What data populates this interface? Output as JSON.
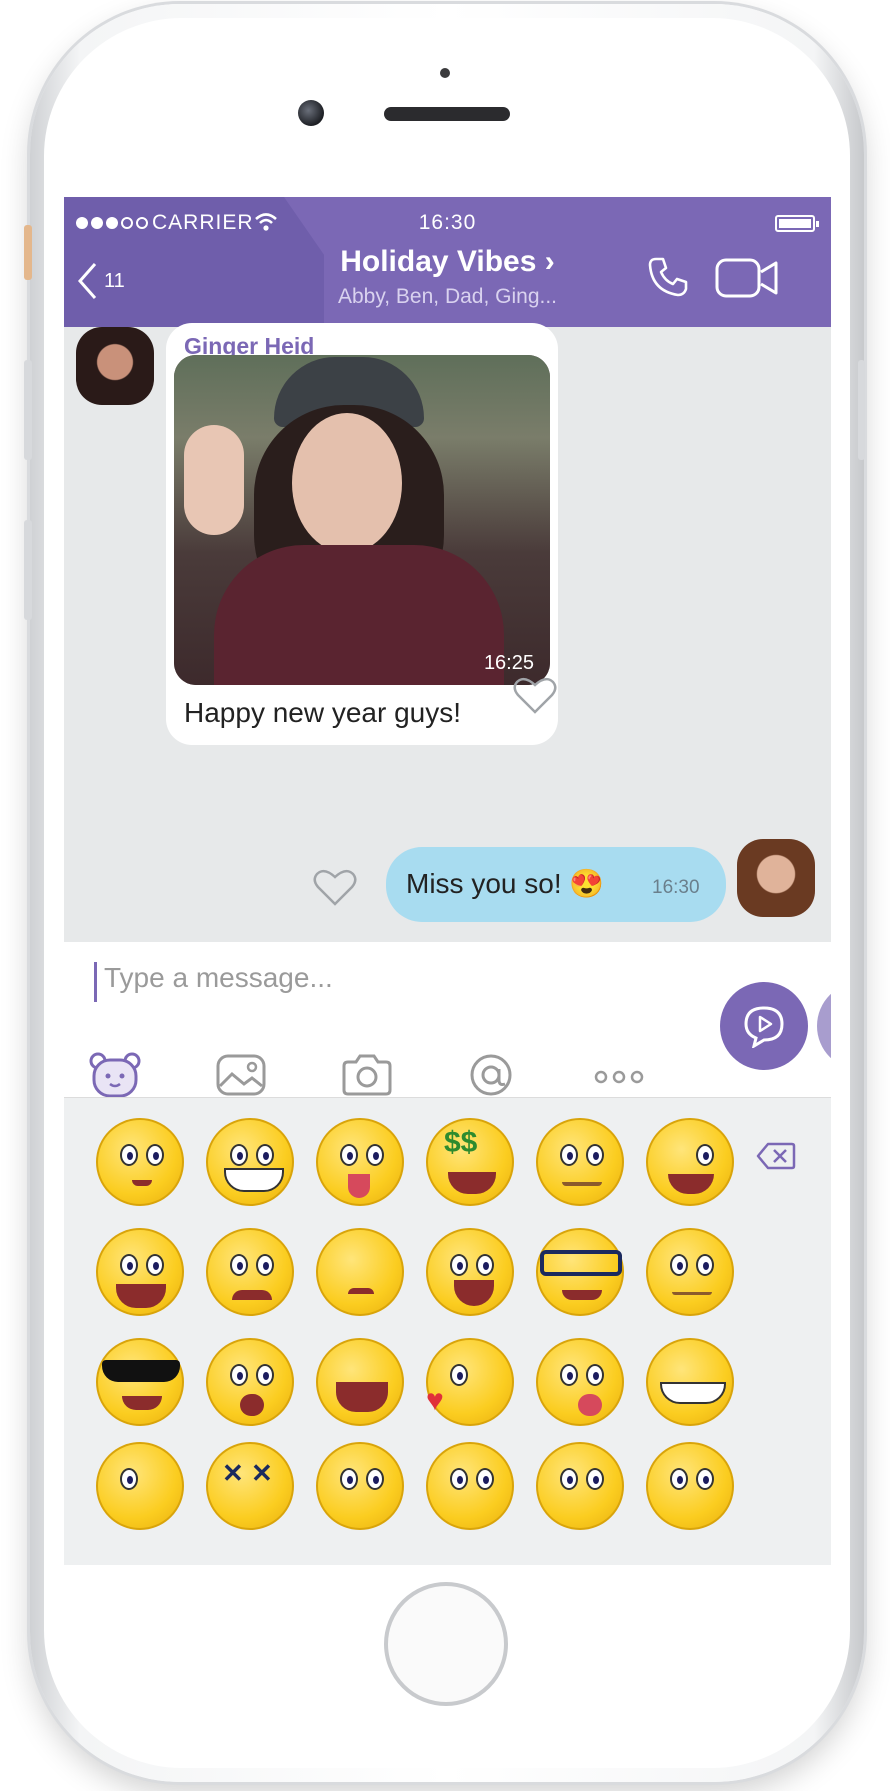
{
  "status_bar": {
    "carrier": "CARRIER",
    "time": "16:30"
  },
  "header": {
    "back_count": "11",
    "title": "Holiday Vibes ›",
    "members": "Abby, Ben, Dad, Ging..."
  },
  "messages": {
    "incoming": {
      "sender": "Ginger Heid",
      "photo_time": "16:25",
      "text": "Happy new year guys!"
    },
    "outgoing": {
      "text": "Miss you so! 😍",
      "time": "16:30"
    }
  },
  "composer": {
    "placeholder": "Type a message..."
  },
  "toolbar": [
    "sticker-icon",
    "gallery-icon",
    "camera-icon",
    "mention-icon",
    "more-icon"
  ],
  "colors": {
    "brand": "#7b68b5",
    "outgoing_bubble": "#a8dcf0",
    "incoming_bubble": "#ffffff"
  },
  "emoji_grid": {
    "rows": 4,
    "columns": 6
  }
}
